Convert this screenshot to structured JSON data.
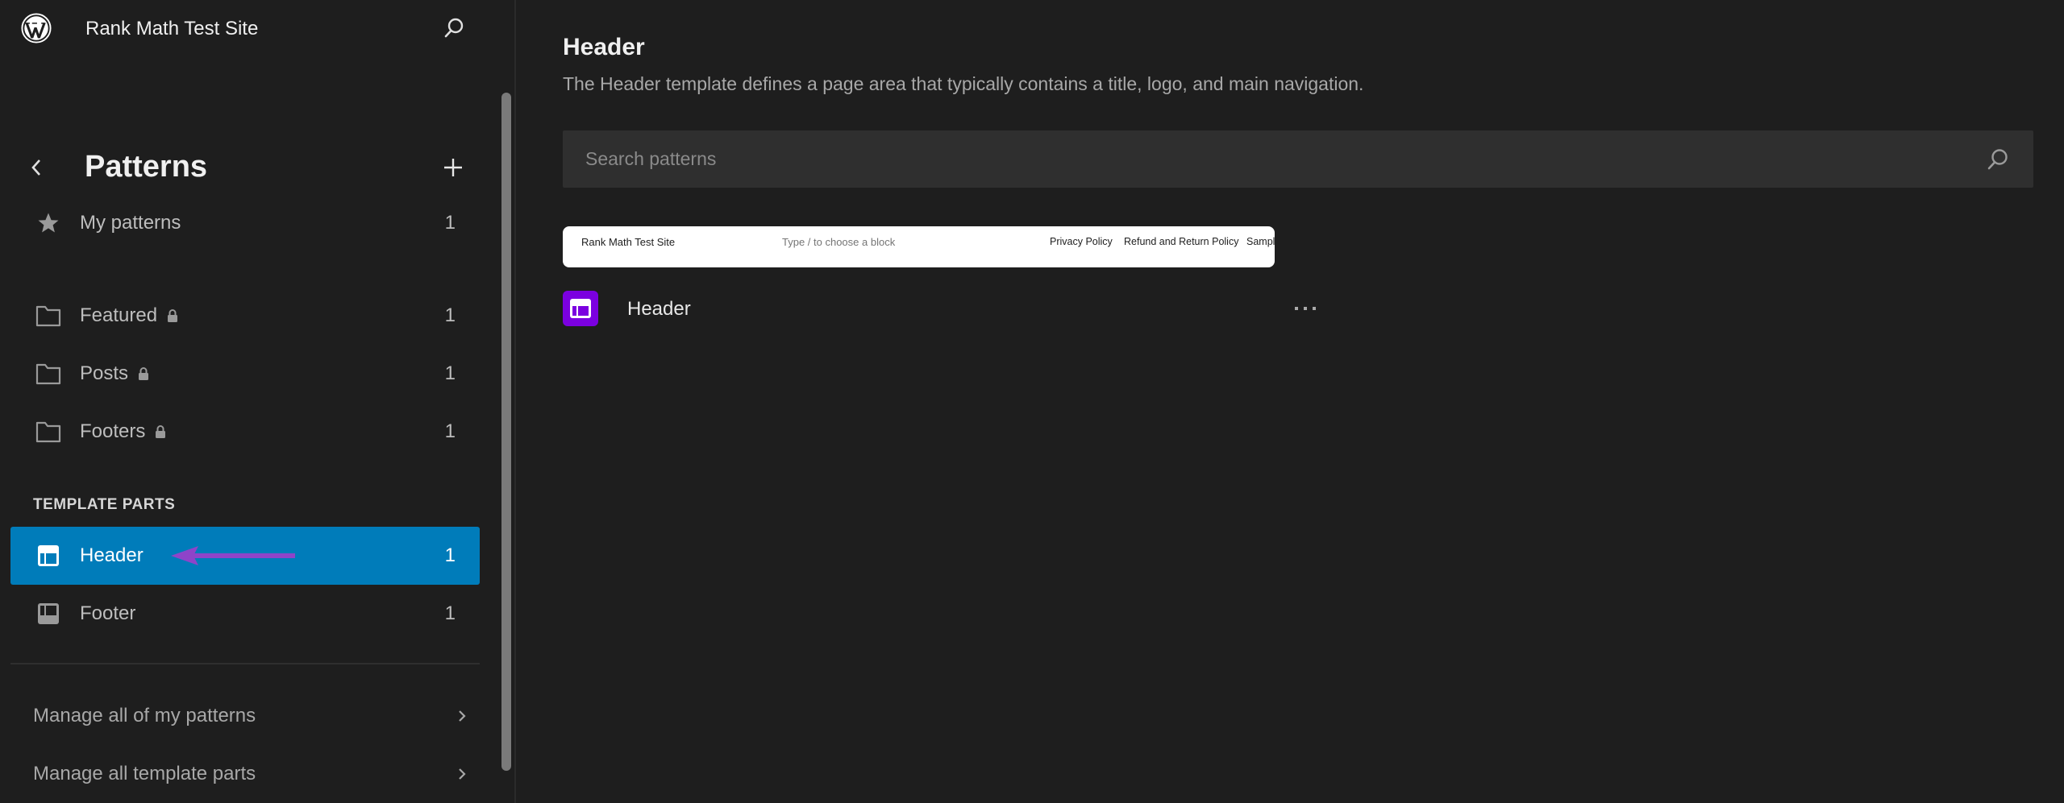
{
  "sidebar": {
    "site_title": "Rank Math Test Site",
    "section_title": "Patterns",
    "items": [
      {
        "label": "My patterns",
        "count": "1",
        "icon": "star-icon",
        "locked": false
      },
      {
        "label": "Featured",
        "count": "1",
        "icon": "folder-icon",
        "locked": true
      },
      {
        "label": "Posts",
        "count": "1",
        "icon": "folder-icon",
        "locked": true
      },
      {
        "label": "Footers",
        "count": "1",
        "icon": "folder-icon",
        "locked": true
      }
    ],
    "template_parts_label": "TEMPLATE PARTS",
    "template_parts": [
      {
        "label": "Header",
        "count": "1",
        "icon": "header-layout-icon",
        "active": true
      },
      {
        "label": "Footer",
        "count": "1",
        "icon": "footer-layout-icon",
        "active": false
      }
    ],
    "manage_links": [
      {
        "label": "Manage all of my patterns"
      },
      {
        "label": "Manage all template parts"
      }
    ]
  },
  "main": {
    "title": "Header",
    "description": "The Header template defines a page area that typically contains a title, logo, and main navigation.",
    "search": {
      "placeholder": "Search patterns",
      "value": ""
    },
    "patterns": [
      {
        "label": "Header",
        "preview": {
          "site_title": "Rank Math Test Site",
          "block_hint": "Type / to choose a block",
          "nav": [
            "Privacy Policy",
            "Refund and Return Policy",
            "Sample Page"
          ]
        }
      }
    ]
  },
  "colors": {
    "background": "#1e1e1e",
    "accent": "#007cba",
    "pattern_icon": "#7b00e0",
    "annotation_arrow": "#8e44c9"
  }
}
